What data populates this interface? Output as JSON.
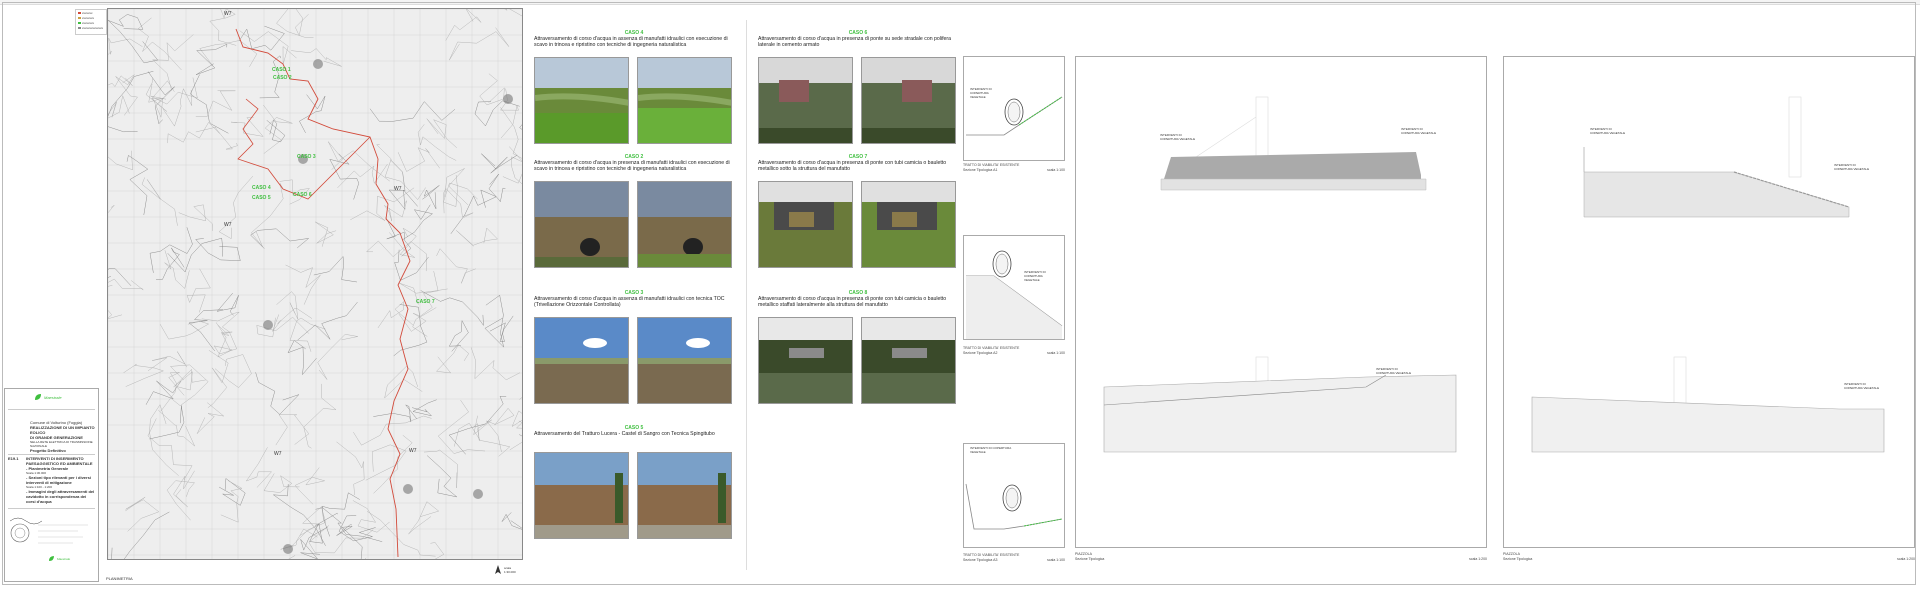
{
  "legend": {
    "items": [
      {
        "label": "xxxxxxx",
        "color": "#d24a3a"
      },
      {
        "label": "xxxxxxxx",
        "color": "#c8a040"
      },
      {
        "label": "xxxxxxxx",
        "color": "#3fbf3f"
      },
      {
        "label": "xxxxxxxxxxxxxx",
        "color": "#888888"
      }
    ]
  },
  "titleblock": {
    "company": "Maestrale",
    "comune": "Comune di Volturino (Foggia)",
    "title_line1": "REALIZZAZIONE DI UN IMPIANTO EOLICO",
    "title_line2": "DI GRANDE GENERAZIONE",
    "subtitle": "NELLA RETE ELETTRICA DI TRASMISSIONE NAZIONALE",
    "project": "Progetto Definitivo",
    "code": "E19.1",
    "doc_title": "INTERVENTI DI INSERIMENTO PAESAGGISTICO ED AMBIENTALE",
    "item1": "- Planimetria Generale",
    "scale1": "Scala 1:30.000",
    "item2": "- Sezioni tipo rilevanti per i diversi interventi di mitigazione",
    "scale2": "Scala 1:100 - 1:200",
    "item3": "- Immagini degli attraversamenti del cavidotto in corrispondenza dei corsi d'acqua",
    "company_footer": "Maestrale"
  },
  "map": {
    "labels": [
      "W7",
      "W7",
      "W7",
      "W7",
      "W7"
    ],
    "cases": [
      "CASO 1",
      "CASO 2",
      "CASO 3",
      "CASO 4",
      "CASO 5",
      "CASO 6",
      "CASO 7"
    ],
    "bottom_label": "PLANIMETRIA",
    "scale_label": "scala 1:30.000"
  },
  "cases": {
    "c4": {
      "label": "CASO 4",
      "text": "Attraversamento di corso d'acqua in assenza di manufatti idraulici con esecuzione di scavo in trincea e ripristino con tecniche di ingegneria naturalistica"
    },
    "c2": {
      "label": "CASO 2",
      "text": "Attraversamento di corso d'acqua in presenza di manufatti idraulici con esecuzione di scavo in trincea e ripristino con tecniche di ingegneria naturalistica"
    },
    "c3": {
      "label": "CASO 3",
      "text": "Attraversamento di corso d'acqua in assenza di manufatti idraulici con tecnica TOC (Trivellazione Orizzontale Controllata)"
    },
    "c5": {
      "label": "CASO 5",
      "text": "Attraversamento del Tratturo Lucera - Castel di Sangro con Tecnica Spingitubo"
    },
    "c6": {
      "label": "CASO 6",
      "text": "Attraversamento di corso d'acqua in presenza di ponte su sede stradale con polifera laterale in cemento armato"
    },
    "c7": {
      "label": "CASO 7",
      "text": "Attraversamento di corso d'acqua in presenza di ponte con tubi camicia o bauletto metallico sotto la struttura del manufatto"
    },
    "c8": {
      "label": "CASO 8",
      "text": "Attraversamento di corso d'acqua in presenza di ponte con tubi camicia o bauletto metallico staffati lateralmente alla struttura del manufatto"
    }
  },
  "sections": {
    "s1": {
      "title": "TRATTO DI VIABILITA' ESISTENTE",
      "subtitle": "Sezione Tipologica A1",
      "scale": "scala 1:100"
    },
    "s2": {
      "title": "TRATTO DI VIABILITA' ESISTENTE",
      "subtitle": "Sezione Tipologica A2",
      "scale": "scala 1:100"
    },
    "s3": {
      "title": "TRATTO DI VIABILITA' ESISTENTE",
      "subtitle": "Sezione Tipologica A3",
      "scale": "scala 1:100"
    },
    "p1": {
      "title": "PIAZZOLA",
      "subtitle": "Sezione Tipologica",
      "scale": "scala 1:200"
    },
    "p2": {
      "title": "PIAZZOLA",
      "subtitle": "Sezione Tipologica",
      "scale": "scala 1:200"
    },
    "note": "INTERVENTI DI COPERTURA VEGETALE"
  },
  "colors": {
    "accent": "#3fbf3f",
    "route": "#d24a3a",
    "line": "#999999"
  }
}
